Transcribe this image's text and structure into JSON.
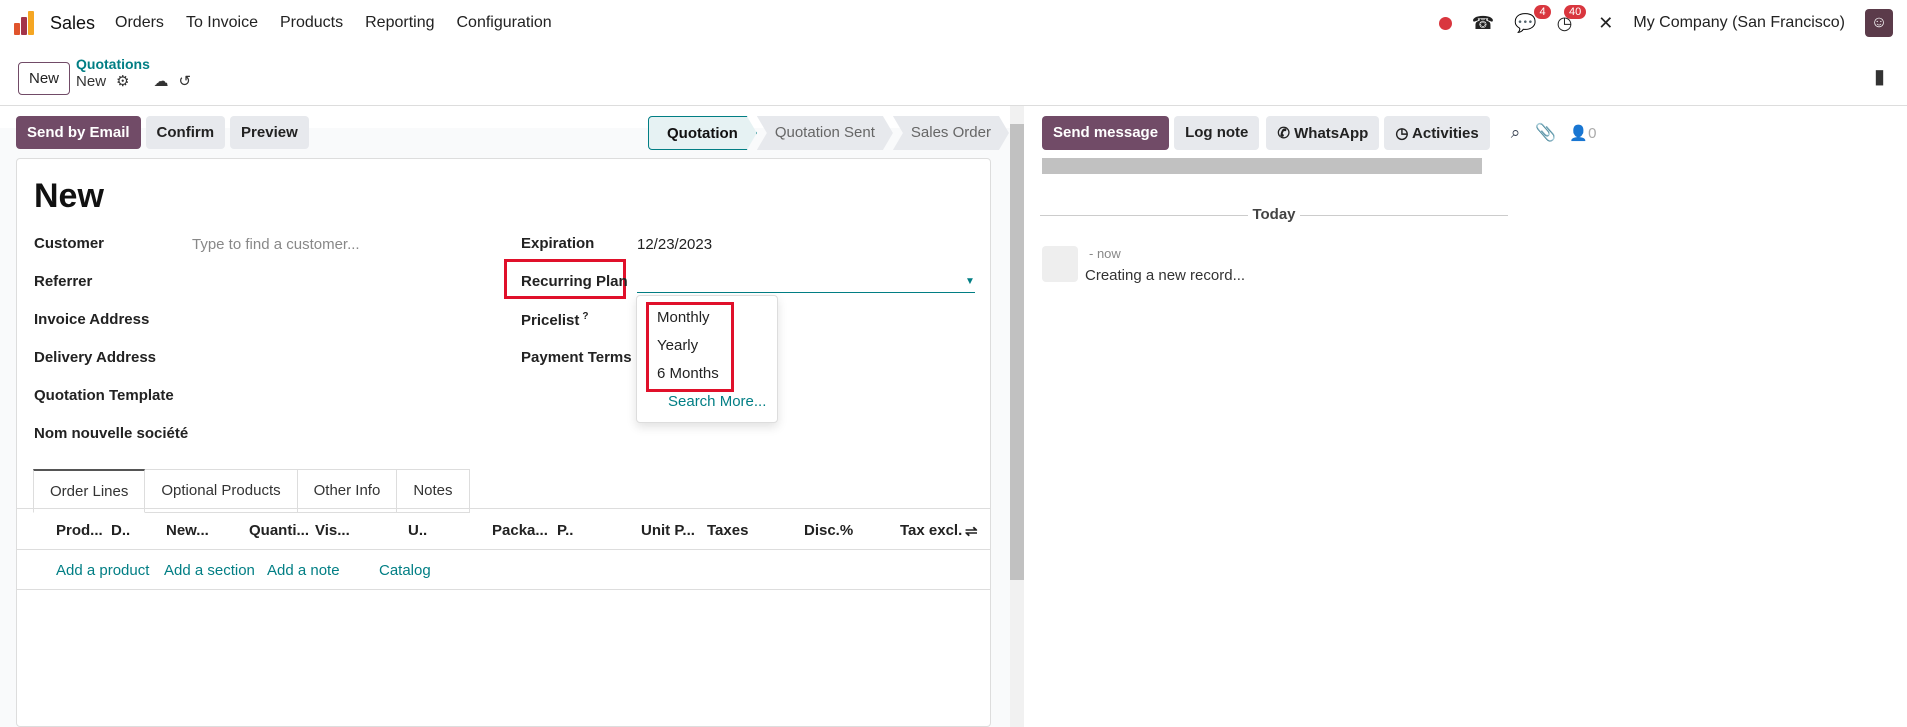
{
  "nav": {
    "app": "Sales",
    "menus": [
      "Orders",
      "To Invoice",
      "Products",
      "Reporting",
      "Configuration"
    ],
    "company": "My Company (San Francisco)",
    "messages_count": "4",
    "activities_count": "40"
  },
  "control": {
    "new": "New",
    "breadcrumb_parent": "Quotations",
    "breadcrumb_current": "New"
  },
  "actions": {
    "send_email": "Send by Email",
    "confirm": "Confirm",
    "preview": "Preview"
  },
  "statusbar": [
    "Quotation",
    "Quotation Sent",
    "Sales Order"
  ],
  "form": {
    "title": "New",
    "customer_label": "Customer",
    "customer_placeholder": "Type to find a customer...",
    "referrer": "Referrer",
    "invoice_address": "Invoice Address",
    "delivery_address": "Delivery Address",
    "quotation_template": "Quotation Template",
    "nom": "Nom nouvelle société",
    "expiration_label": "Expiration",
    "expiration": "12/23/2023",
    "recurring_plan": "Recurring Plan",
    "pricelist": "Pricelist",
    "pricelist_help": "?",
    "payment_terms": "Payment Terms"
  },
  "dropdown": {
    "options": [
      "Monthly",
      "Yearly",
      "6 Months"
    ],
    "search_more": "Search More..."
  },
  "tabs": [
    "Order Lines",
    "Optional Products",
    "Other Info",
    "Notes"
  ],
  "columns": [
    "Prod...",
    "D..",
    "New...",
    "Quanti...",
    "Vis...",
    "U..",
    "Packa...",
    "P..",
    "Unit P...",
    "Taxes",
    "Disc.%",
    "Tax excl."
  ],
  "line_actions": [
    "Add a product",
    "Add a section",
    "Add a note",
    "Catalog"
  ],
  "chatter": {
    "send_message": "Send message",
    "log_note": "Log note",
    "whatsapp": "WhatsApp",
    "activities": "Activities",
    "followers": "0",
    "today": "Today",
    "time": "- now",
    "message": "Creating a new record..."
  },
  "colors": {
    "primary": "#714b67",
    "link": "#017e84",
    "highlight": "#e0102a"
  }
}
